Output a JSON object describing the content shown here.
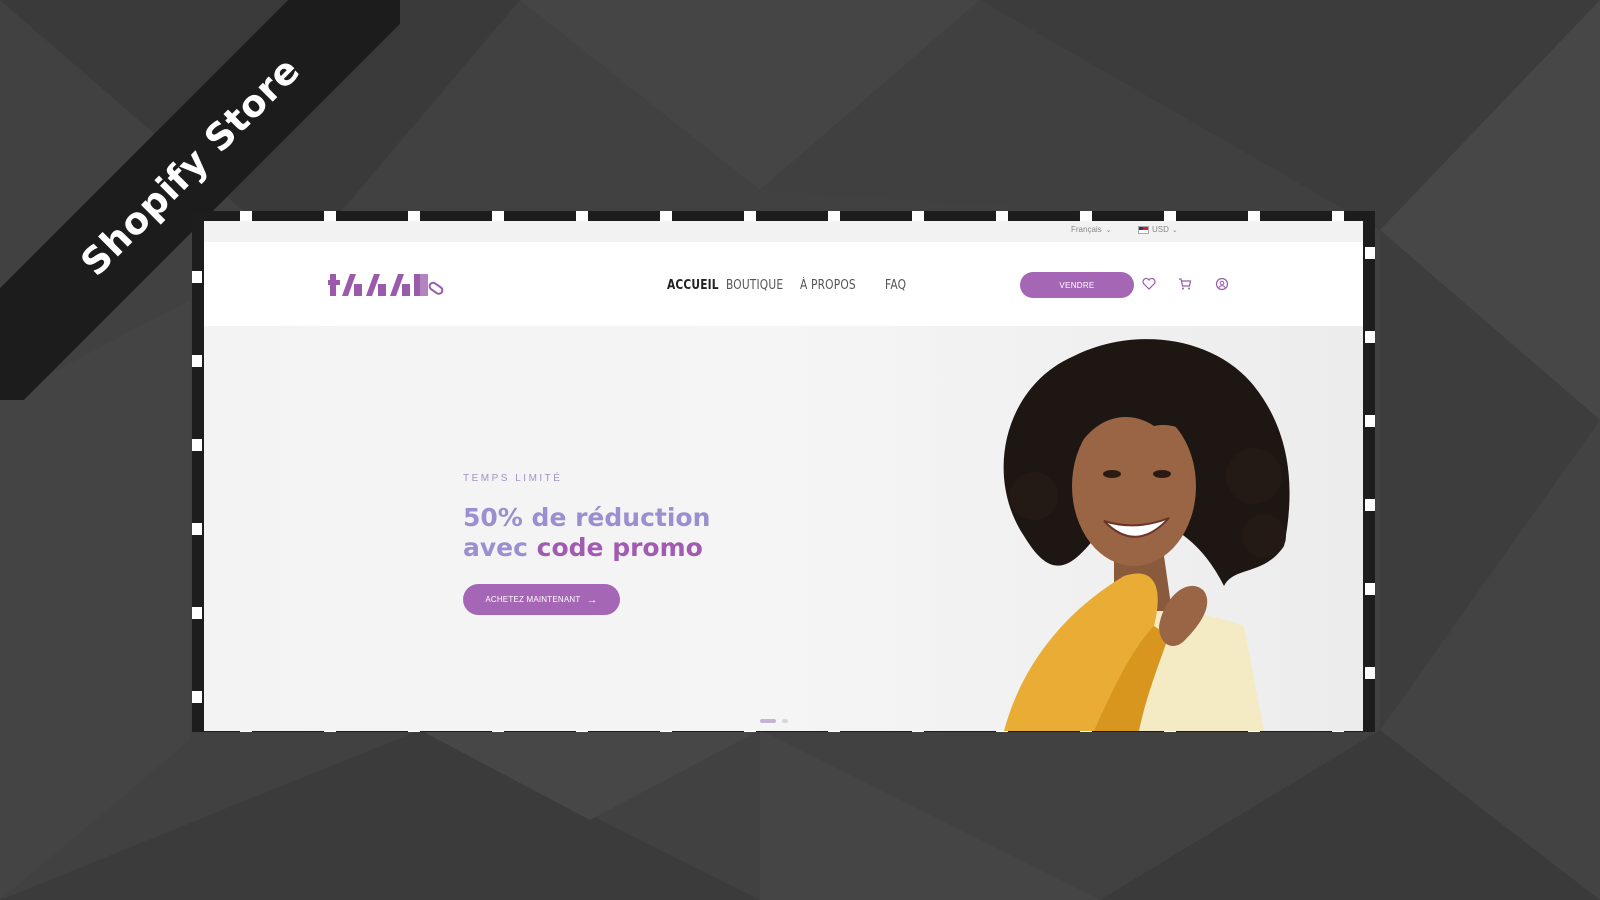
{
  "page": {
    "ribbon_label": "Shopify Store",
    "background_color": "#3e3e3e"
  },
  "store": {
    "topbar": {
      "language": "Français",
      "currency": "USD"
    },
    "logo_alt": "logo",
    "nav": [
      {
        "label": "ACCUEIL",
        "active": true
      },
      {
        "label": "BOUTIQUE",
        "active": false
      },
      {
        "label": "À PROPOS",
        "active": false
      },
      {
        "label": "FAQ",
        "active": false
      }
    ],
    "sell_button": "VENDRE",
    "icons": [
      "heart-icon",
      "cart-icon",
      "account-icon"
    ],
    "hero": {
      "eyebrow": "TEMPS LIMITÉ",
      "headline_line1": "50% de réduction",
      "headline_line2_prefix": "avec ",
      "headline_line2_accent": "code promo",
      "cta_label": "ACHETEZ MAINTENANT",
      "accent_color": "#a567b5"
    }
  }
}
